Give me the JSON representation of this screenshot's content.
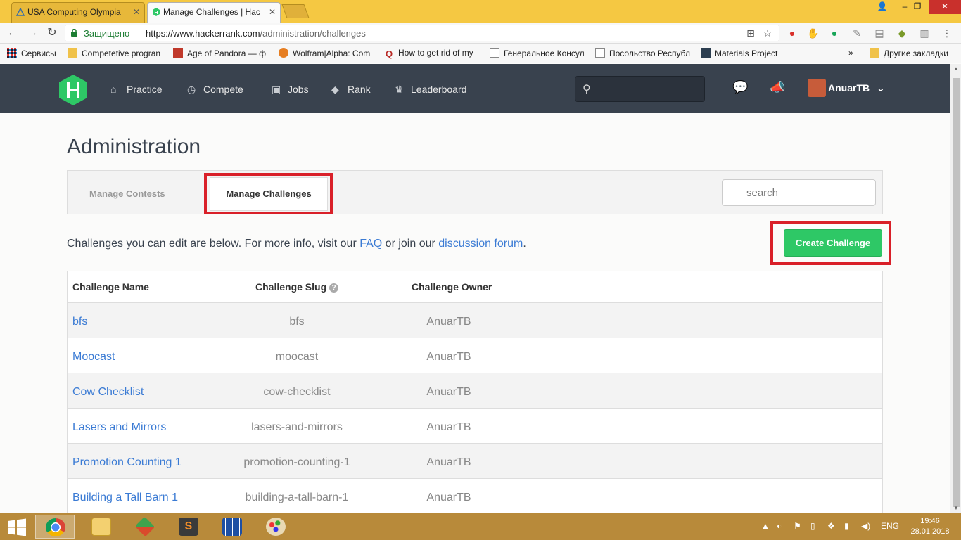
{
  "browser": {
    "tabs": [
      {
        "label": "USA Computing Olympia",
        "active": false
      },
      {
        "label": "Manage Challenges | Hac",
        "active": true
      }
    ],
    "secure_label": "Защищено",
    "url_host": "https://www.hackerrank.com",
    "url_path": "/administration/challenges",
    "bookmarks": [
      "Сервисы",
      "Competetive progran",
      "Age of Pandora — ф",
      "Wolfram|Alpha: Com",
      "How to get rid of my",
      "Генеральное Консул",
      "Посольство Республ",
      "Materials Project"
    ],
    "bookmarks_overflow": "»",
    "other_bookmarks": "Другие закладки"
  },
  "hr_nav": {
    "items": [
      "Practice",
      "Compete",
      "Jobs",
      "Rank",
      "Leaderboard"
    ],
    "username": "AnuarTB"
  },
  "page": {
    "title": "Administration",
    "tabs": {
      "manage_contests": "Manage Contests",
      "manage_challenges": "Manage Challenges"
    },
    "search_placeholder": "search",
    "intro_text": "Challenges you can edit are below. For more info, visit our ",
    "faq_link": "FAQ",
    "intro_mid": " or join our ",
    "forum_link": "discussion forum",
    "intro_end": ".",
    "create_button": "Create Challenge"
  },
  "table": {
    "headers": {
      "name": "Challenge Name",
      "slug": "Challenge Slug",
      "owner": "Challenge Owner"
    },
    "rows": [
      {
        "name": "bfs",
        "slug": "bfs",
        "owner": "AnuarTB"
      },
      {
        "name": "Moocast",
        "slug": "moocast",
        "owner": "AnuarTB"
      },
      {
        "name": "Cow Checklist",
        "slug": "cow-checklist",
        "owner": "AnuarTB"
      },
      {
        "name": "Lasers and Mirrors",
        "slug": "lasers-and-mirrors",
        "owner": "AnuarTB"
      },
      {
        "name": "Promotion Counting 1",
        "slug": "promotion-counting-1",
        "owner": "AnuarTB"
      },
      {
        "name": "Building a Tall Barn 1",
        "slug": "building-a-tall-barn-1",
        "owner": "AnuarTB"
      }
    ]
  },
  "taskbar": {
    "language": "ENG",
    "time": "19:46",
    "date": "28.01.2018"
  },
  "colors": {
    "hr_nav_bg": "#39424e",
    "hr_green": "#2ec866",
    "link_blue": "#3b7bd4",
    "highlight_red": "#d92029",
    "taskbar_bg": "#b88a3a"
  }
}
